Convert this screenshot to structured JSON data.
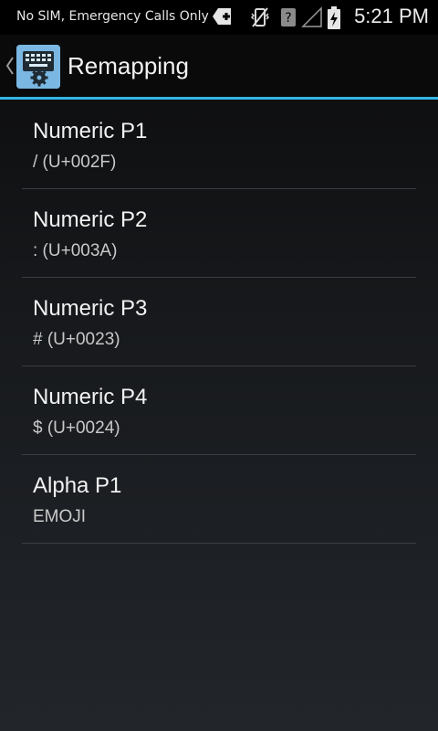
{
  "status_bar": {
    "carrier": "No SIM, Emergency Calls Only",
    "time": "5:21 PM",
    "icons": [
      "add-notification-icon",
      "vibrate-off-icon",
      "no-signal-icon",
      "empty-signal-icon",
      "battery-charging-icon"
    ]
  },
  "action_bar": {
    "title": "Remapping",
    "app_icon": "keyboard-settings-icon",
    "up_icon": "chevron-left-icon",
    "accent_color": "#33b5e5"
  },
  "list": {
    "items": [
      {
        "title": "Numeric P1",
        "summary": "/ (U+002F)"
      },
      {
        "title": "Numeric P2",
        "summary": ": (U+003A)"
      },
      {
        "title": "Numeric P3",
        "summary": "# (U+0023)"
      },
      {
        "title": "Numeric P4",
        "summary": "$ (U+0024)"
      },
      {
        "title": "Alpha P1",
        "summary": "EMOJI"
      }
    ]
  }
}
